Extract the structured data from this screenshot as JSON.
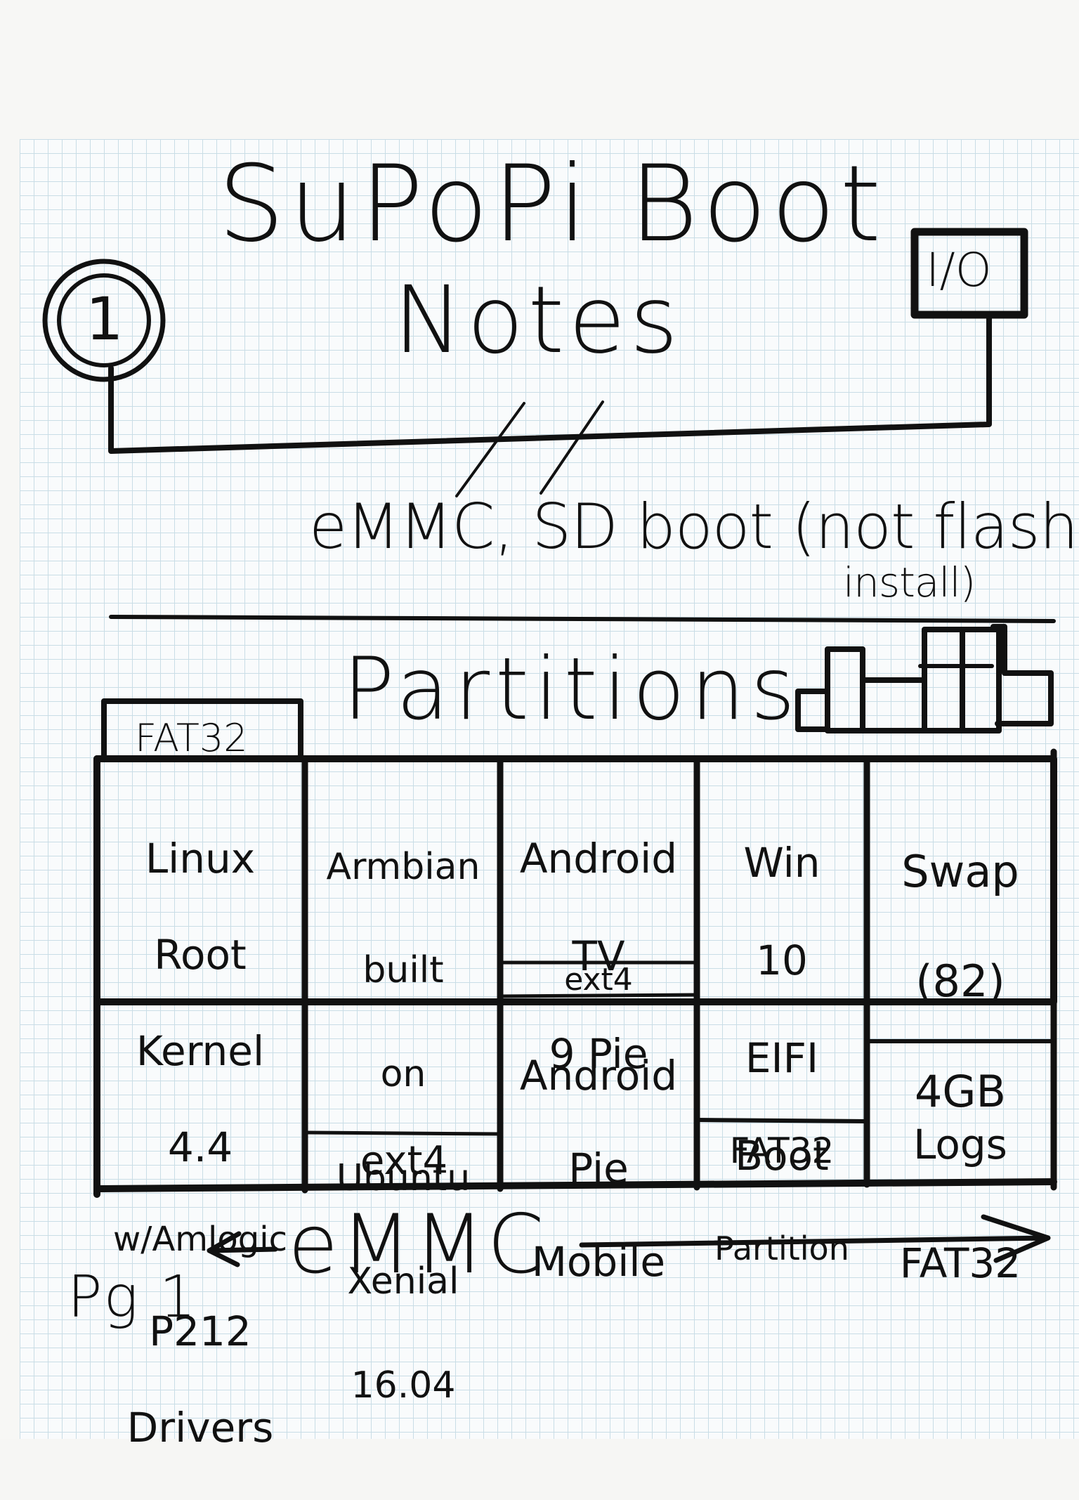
{
  "title_line1": "SuPoPi Boot",
  "title_line2": "Notes",
  "left_badge": "1",
  "right_badge": "I/O",
  "subtitle_line1": "eMMC, SD boot (not flash",
  "subtitle_line2": "install)",
  "section_heading": "Partitions",
  "top_fs_label": "FAT32",
  "columns": [
    {
      "lines": [
        "Linux",
        "Root",
        "Kernel",
        "4.4",
        "w/Amlogic",
        "P212",
        "Drivers"
      ],
      "footer": ""
    },
    {
      "lines": [
        "Armbian",
        "built",
        "on",
        "Ubuntu",
        "Xenial",
        "16.04"
      ],
      "footer": "ext4"
    },
    {
      "lines_top": [
        "Android",
        "TV",
        "9 Pie"
      ],
      "middle": "ext4",
      "lines_bottom": [
        "Android",
        "Pie",
        "Mobile"
      ]
    },
    {
      "lines": [
        "Win",
        "10",
        "EIFI",
        "Boot",
        "Partition"
      ],
      "footer": "FAT32"
    },
    {
      "lines_top": [
        "Swap",
        "(82)",
        "4GB"
      ],
      "lines_bottom": [
        "Logs",
        "FAT32"
      ]
    }
  ],
  "bottom_label": "eMMC",
  "page_label": "Pg 1"
}
